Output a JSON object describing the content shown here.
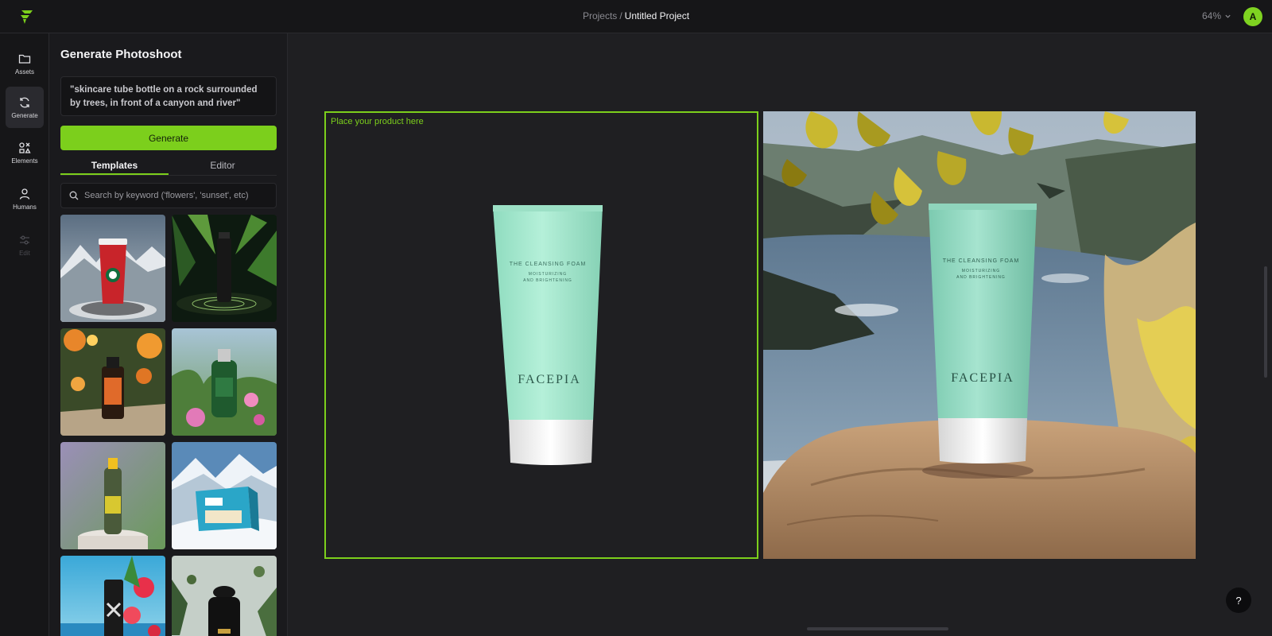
{
  "header": {
    "breadcrumb_root": "Projects",
    "breadcrumb_sep": "/",
    "breadcrumb_current": "Untitled Project",
    "zoom": "64%",
    "avatar_initial": "A"
  },
  "rail": {
    "items": [
      {
        "label": "Assets",
        "icon": "folder-icon"
      },
      {
        "label": "Generate",
        "icon": "refresh-icon",
        "active": true
      },
      {
        "label": "Elements",
        "icon": "shapes-icon"
      },
      {
        "label": "Humans",
        "icon": "person-icon"
      },
      {
        "label": "Edit",
        "icon": "sliders-icon",
        "disabled": true
      }
    ]
  },
  "panel": {
    "title": "Generate Photoshoot",
    "prompt": "\"skincare tube bottle on a rock surrounded by trees, in front of a canyon and river\"",
    "generate_label": "Generate",
    "tabs": [
      {
        "label": "Templates",
        "active": true
      },
      {
        "label": "Editor"
      }
    ],
    "search_placeholder": "Search by keyword ('flowers', 'sunset', etc)"
  },
  "canvas": {
    "drop_label": "Place your product here",
    "product_brand": "FACEPIA",
    "product_name": "THE CLEANSING FOAM",
    "product_sub1": "MOISTURIZING",
    "product_sub2": "AND BRIGHTENING"
  },
  "help_label": "?",
  "colors": {
    "accent": "#7ccf1c",
    "background": "#1f1f22",
    "panel": "#1a1a1d",
    "tube": "#a8ecd3"
  }
}
